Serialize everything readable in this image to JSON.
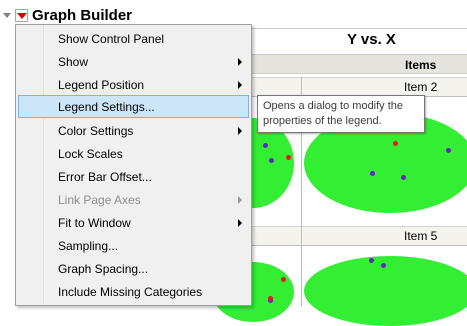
{
  "window": {
    "title": "Graph Builder",
    "plot_title": "Y vs. X",
    "column_header": "Items",
    "panels": [
      "Item 2",
      "Item 5"
    ]
  },
  "menu": {
    "items": [
      {
        "label": "Show Control Panel",
        "submenu": false,
        "enabled": true
      },
      {
        "label": "Show",
        "submenu": true,
        "enabled": true
      },
      {
        "label": "Legend Position",
        "submenu": true,
        "enabled": true
      },
      {
        "label": "Legend Settings...",
        "submenu": false,
        "enabled": true,
        "highlighted": true
      },
      {
        "label": "Color Settings",
        "submenu": true,
        "enabled": true
      },
      {
        "label": "Lock Scales",
        "submenu": false,
        "enabled": true
      },
      {
        "label": "Error Bar Offset...",
        "submenu": false,
        "enabled": true
      },
      {
        "label": "Link Page Axes",
        "submenu": true,
        "enabled": false
      },
      {
        "label": "Fit to Window",
        "submenu": true,
        "enabled": true
      },
      {
        "label": "Sampling...",
        "submenu": false,
        "enabled": true
      },
      {
        "label": "Graph Spacing...",
        "submenu": false,
        "enabled": true
      },
      {
        "label": "Include Missing Categories",
        "submenu": false,
        "enabled": true
      }
    ]
  },
  "tooltip": {
    "line1": "Opens a dialog to modify the",
    "line2": "properties of the legend."
  },
  "colors": {
    "ellipse_fill": "#33ee33",
    "point_purple": "#6a1fd0",
    "point_red": "#e31a1c",
    "menu_highlight": "#cde6f7",
    "red_triangle": "#e00000"
  }
}
